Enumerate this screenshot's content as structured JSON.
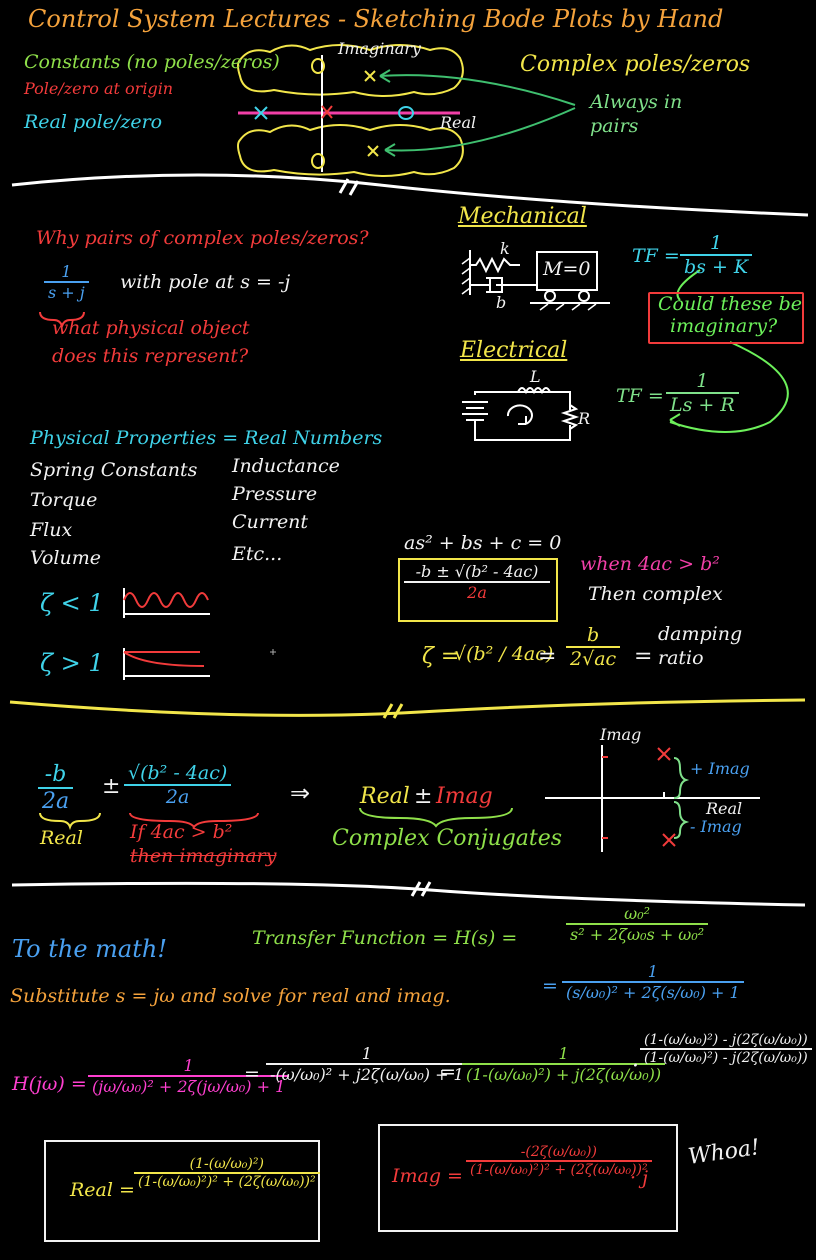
{
  "title": "Control System Lectures - Sketching Bode Plots by Hand",
  "section1": {
    "constants": "Constants (no poles/zeros)",
    "origin": "Pole/zero at origin",
    "real_pole": "Real pole/zero",
    "imaginary_axis": "Imaginary",
    "real_axis": "Real",
    "complex": "Complex poles/zeros",
    "always_pairs_1": "Always in",
    "always_pairs_2": "pairs"
  },
  "section2": {
    "question": "Why pairs of complex poles/zeros?",
    "frac_num": "1",
    "frac_den": "s + j",
    "with_pole": "with pole at s = -j",
    "what_obj_1": "what physical object",
    "what_obj_2": "does this represent?",
    "mechanical": "Mechanical",
    "spring_k": "k",
    "damper_b": "b",
    "mass": "M=0",
    "tf_label": "TF =",
    "tf_mech_num": "1",
    "tf_mech_den": "bs + K",
    "could_1": "Could these be",
    "could_2": "imaginary?",
    "electrical": "Electrical",
    "ind_l": "L",
    "res_r": "R",
    "tf_elec_num": "1",
    "tf_elec_den": "Ls + R"
  },
  "section3": {
    "physical": "Physical Properties = Real Numbers",
    "left_list": [
      "Spring Constants",
      "Torque",
      "Flux",
      "Volume"
    ],
    "right_list": [
      "Inductance",
      "Pressure",
      "Current",
      "Etc..."
    ],
    "zeta_lt": "ζ < 1",
    "zeta_gt": "ζ > 1",
    "quad_eq": "as² + bs + c = 0",
    "quad_num": "-b ± √(b² - 4ac)",
    "quad_den": "2a",
    "when": "when 4ac > b²",
    "then": "Then complex",
    "zeta_eq": "ζ =",
    "zeta_sqrt": "√(b² / 4ac)",
    "eq": "=",
    "zeta_frac_num": "b",
    "zeta_frac_den": "2√ac",
    "damping_1": "damping",
    "damping_2": "ratio"
  },
  "section4": {
    "neg_b": "-b",
    "two_a": "2a",
    "pm": "±",
    "root_num": "√(b² - 4ac)",
    "root_den": "2a",
    "real": "Real",
    "if_line": "If 4ac > b²",
    "then_imag": "then imaginary",
    "arrow": "⇒",
    "real_pm_imag_real": "Real",
    "real_pm_imag_pm": "±",
    "real_pm_imag_imag": "Imag",
    "conjugates": "Complex Conjugates",
    "imag_axis": "Imag",
    "plus_imag": "+ Imag",
    "real_lbl": "Real",
    "minus_imag": "- Imag"
  },
  "section5": {
    "to_math": "To the math!",
    "tf_text": "Transfer Function = H(s) =",
    "tf_num": "ω₀²",
    "tf_den": "s² + 2ζω₀s + ω₀²",
    "substitute": "Substitute s = jω and solve for real and imag.",
    "eq2": "=",
    "tf2_num": "1",
    "tf2_den": "(s/ω₀)² + 2ζ(s/ω₀) + 1",
    "hjw": "H(jω) =",
    "h1_num": "1",
    "h1_den": "(jω/ω₀)² + 2ζ(jω/ω₀) + 1",
    "eq3": "=",
    "h2_num": "1",
    "h2_den": "-(ω/ω₀)² + j2ζ(ω/ω₀) + 1",
    "eq4": "=",
    "h3_num": "1",
    "h3_den": "(1-(ω/ω₀)²) + j(2ζ(ω/ω₀))",
    "dot": "·",
    "h4_num": "(1-(ω/ω₀)²) - j(2ζ(ω/ω₀))",
    "h4_den": "(1-(ω/ω₀)²) - j(2ζ(ω/ω₀))",
    "real_label": "Real =",
    "real_num": "(1-(ω/ω₀)²)",
    "real_den": "(1-(ω/ω₀)²)² + (2ζ(ω/ω₀))²",
    "imag_label": "Imag =",
    "imag_num": "-(2ζ(ω/ω₀))",
    "imag_den": "(1-(ω/ω₀)²)² + (2ζ(ω/ω₀))²",
    "imag_j": "· j",
    "whoa": "Whoa!"
  },
  "colors": {
    "background": "#000000",
    "orange": "#f4a23c",
    "green": "#8fe04a",
    "red": "#f23b3b",
    "cyan": "#3fd2e8",
    "yellow": "#f2e64a",
    "white": "#f2f2f2",
    "pink": "#f23fa8"
  }
}
